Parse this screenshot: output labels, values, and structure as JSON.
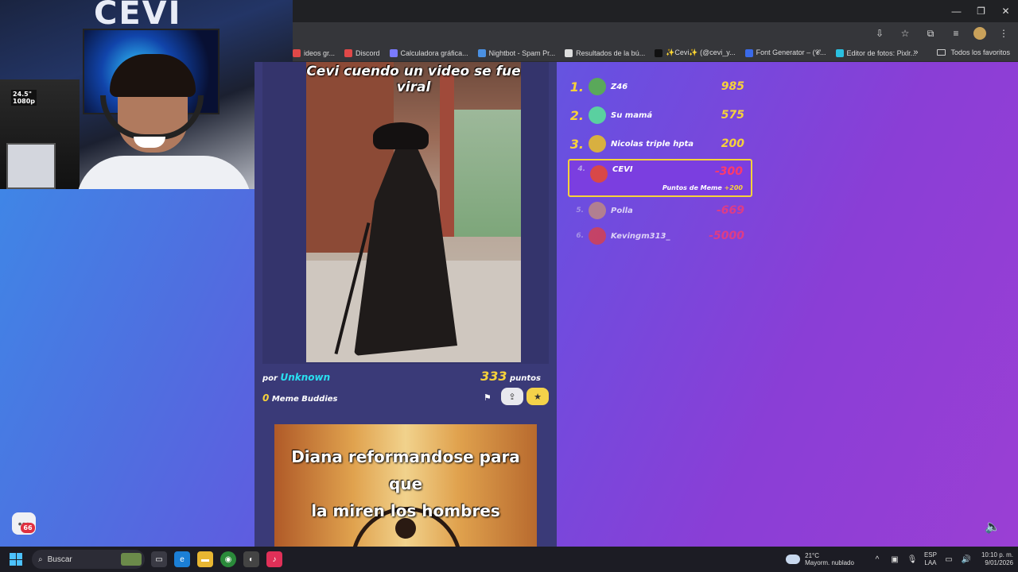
{
  "browser": {
    "bookmarks": [
      {
        "label": "ideos gr...",
        "color": "#e04848"
      },
      {
        "label": "Discord",
        "color": "#e04848"
      },
      {
        "label": "Calculadora gráfica...",
        "color": "#7a7aff"
      },
      {
        "label": "Nightbot - Spam Pr...",
        "color": "#4a90e2"
      },
      {
        "label": "Resultados de la bú...",
        "color": "#dddddd"
      },
      {
        "label": "✨Cevi✨ (@cevi_y...",
        "color": "#111111"
      },
      {
        "label": "Font Generator – (𝓒...",
        "color": "#3a6ae8"
      },
      {
        "label": "Editor de fotos: Pixlr...",
        "color": "#2ac0e0"
      }
    ],
    "overflow_glyph": "»",
    "all_bookmarks": "Todos los favoritos"
  },
  "webcam": {
    "logo": "CEVI",
    "monitor_label_line1": "24.5\"",
    "monitor_label_line2": "1080p"
  },
  "feed": {
    "post1": {
      "caption": "Cevi cuendo un video se fue viral",
      "by_label": "por",
      "author": "Unknown",
      "points_value": "333",
      "points_label": "puntos",
      "buddies_count": "0",
      "buddies_label": "Meme Buddies"
    },
    "post2": {
      "caption_line1": "Diana reformandose para que",
      "caption_line2": "la miren los hombres"
    }
  },
  "leaderboard": {
    "rows": [
      {
        "rank": "1.",
        "name": "Z46",
        "score": "985",
        "avatar_color": "#5aa85a"
      },
      {
        "rank": "2.",
        "name": "Su mamá",
        "score": "575",
        "avatar_color": "#5ad0a0"
      },
      {
        "rank": "3.",
        "name": "Nicolas triple hpta",
        "score": "200",
        "avatar_color": "#d8b040"
      },
      {
        "rank": "4.",
        "name": "CEVI",
        "score": "-300",
        "avatar_color": "#d84848",
        "sub_label": "Puntos de Meme",
        "sub_value": "+200"
      },
      {
        "rank": "5.",
        "name": "Polla",
        "score": "-669",
        "avatar_color": "#c89078"
      },
      {
        "rank": "6.",
        "name": "Kevingm313_",
        "score": "-5000",
        "avatar_color": "#e04040"
      }
    ]
  },
  "chat_badge": "66",
  "taskbar": {
    "search_placeholder": "Buscar",
    "weather_temp": "21°C",
    "weather_desc": "Mayorm. nublado",
    "lang_line1": "ESP",
    "lang_line2": "LAA",
    "time": "10:10 p. m.",
    "date": "9/01/2026"
  }
}
